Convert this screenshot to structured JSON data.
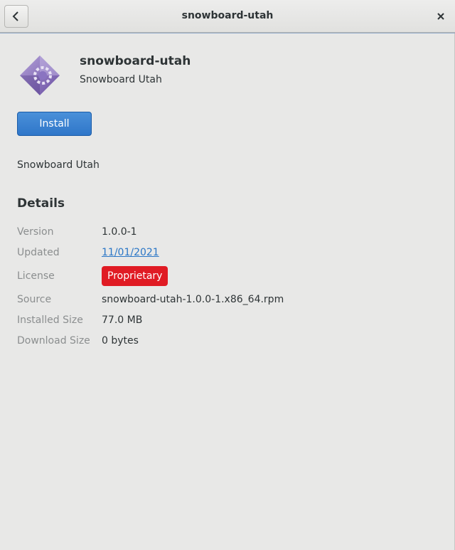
{
  "header": {
    "title": "snowboard-utah"
  },
  "app": {
    "name": "snowboard-utah",
    "summary": "Snowboard Utah",
    "install_label": "Install",
    "description": "Snowboard Utah"
  },
  "details": {
    "heading": "Details",
    "version_label": "Version",
    "version_value": "1.0.0-1",
    "updated_label": "Updated",
    "updated_value": "11/01/2021",
    "license_label": "License",
    "license_value": "Proprietary",
    "source_label": "Source",
    "source_value": "snowboard-utah-1.0.0-1.x86_64.rpm",
    "installed_size_label": "Installed Size",
    "installed_size_value": "77.0 MB",
    "download_size_label": "Download Size",
    "download_size_value": "0 bytes"
  },
  "icons": {
    "back": "back-arrow-icon",
    "close": "close-icon",
    "app": "application-icon"
  },
  "colors": {
    "accent": "#3584e4",
    "license_badge": "#e01b24",
    "link": "#2a76c6"
  }
}
